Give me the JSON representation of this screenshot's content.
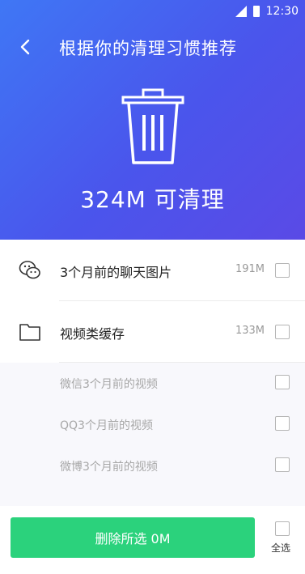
{
  "status": {
    "time": "12:30"
  },
  "header": {
    "title": "根据你的清理习惯推荐",
    "summary": "324M 可清理"
  },
  "items": [
    {
      "icon": "wechat-icon",
      "label": "3个月前的聊天图片",
      "size": "191M",
      "checked": false
    },
    {
      "icon": "folder-icon",
      "label": "视频类缓存",
      "size": "133M",
      "checked": false
    }
  ],
  "sub_items": [
    {
      "label": "微信3个月前的视频",
      "checked": false
    },
    {
      "label": "QQ3个月前的视频",
      "checked": false
    },
    {
      "label": "微博3个月前的视频",
      "checked": false
    }
  ],
  "footer": {
    "delete_label": "删除所选 0M",
    "select_all_label": "全选"
  },
  "colors": {
    "header_gradient": [
      "#3f77f5",
      "#5a4ae6"
    ],
    "button": "#2bd27c"
  }
}
